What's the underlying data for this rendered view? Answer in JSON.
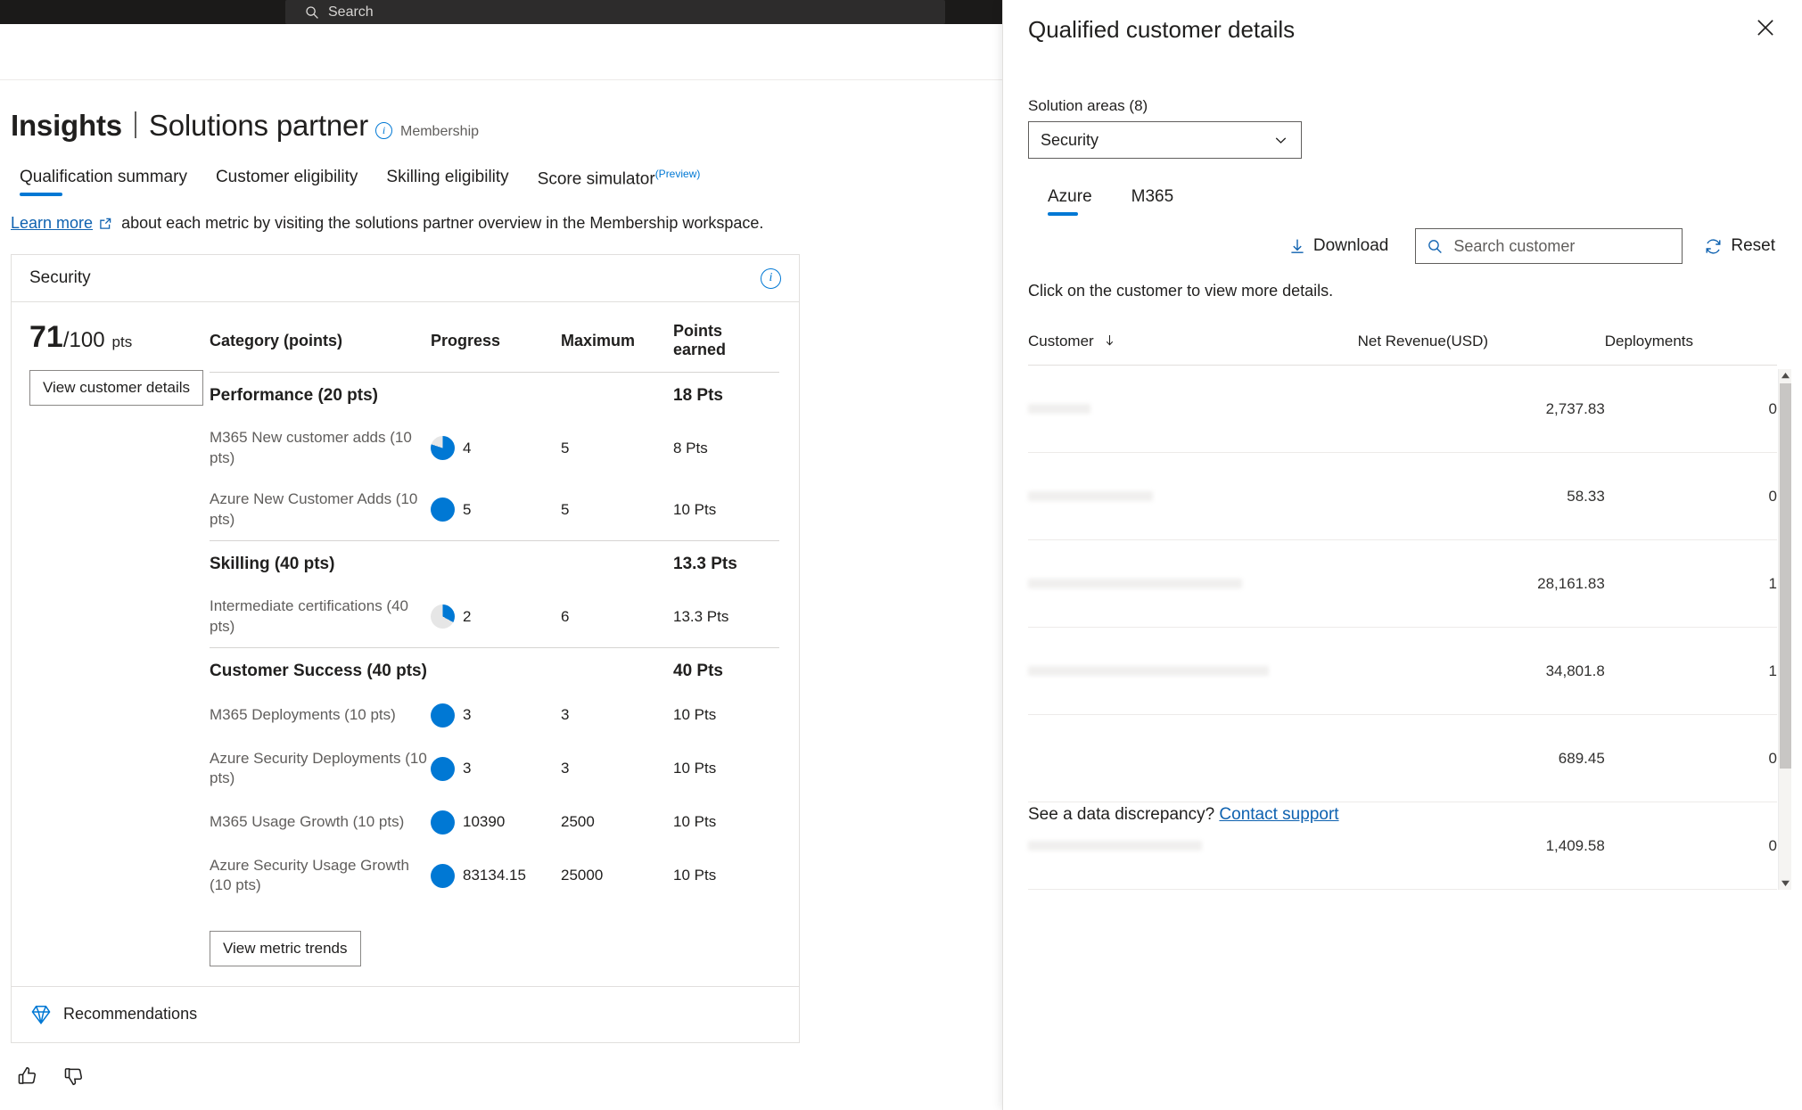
{
  "topbar": {
    "search_placeholder": "Search"
  },
  "header": {
    "title_primary": "Insights",
    "title_secondary": "Solutions partner",
    "subtitle": "Membership",
    "info_glyph": "i"
  },
  "tabs": [
    {
      "label": "Qualification summary",
      "sup": "",
      "active": true
    },
    {
      "label": "Customer eligibility",
      "sup": "",
      "active": false
    },
    {
      "label": "Skilling eligibility",
      "sup": "",
      "active": false
    },
    {
      "label": "Score simulator",
      "sup": "(Preview)",
      "active": false
    }
  ],
  "learn": {
    "link": "Learn more",
    "rest": "about each metric by visiting the solutions partner overview in the Membership workspace."
  },
  "card": {
    "title": "Security",
    "score_value": "71",
    "score_denominator": "/100",
    "score_unit": "pts",
    "view_customer_details": "View customer details",
    "view_metric_trends": "View metric trends",
    "recommendations": "Recommendations",
    "columns": [
      "Category (points)",
      "Progress",
      "Maximum",
      "Points earned"
    ],
    "groups": [
      {
        "name": "Performance (20 pts)",
        "points_earned": "18 Pts",
        "items": [
          {
            "label": "M365 New customer adds (10 pts)",
            "progress": "4",
            "maximum": "5",
            "points_earned": "8 Pts",
            "fill_pct": 80
          },
          {
            "label": "Azure New Customer Adds (10 pts)",
            "progress": "5",
            "maximum": "5",
            "points_earned": "10 Pts",
            "fill_pct": 100
          }
        ]
      },
      {
        "name": "Skilling (40 pts)",
        "points_earned": "13.3 Pts",
        "items": [
          {
            "label": "Intermediate certifications (40 pts)",
            "progress": "2",
            "maximum": "6",
            "points_earned": "13.3 Pts",
            "fill_pct": 33
          }
        ]
      },
      {
        "name": "Customer Success (40 pts)",
        "points_earned": "40 Pts",
        "items": [
          {
            "label": "M365 Deployments (10 pts)",
            "progress": "3",
            "maximum": "3",
            "points_earned": "10 Pts",
            "fill_pct": 100
          },
          {
            "label": "Azure Security Deployments (10 pts)",
            "progress": "3",
            "maximum": "3",
            "points_earned": "10 Pts",
            "fill_pct": 100
          },
          {
            "label": "M365 Usage Growth (10 pts)",
            "progress": "10390",
            "maximum": "2500",
            "points_earned": "10 Pts",
            "fill_pct": 100
          },
          {
            "label": "Azure Security Usage Growth (10 pts)",
            "progress": "83134.15",
            "maximum": "25000",
            "points_earned": "10 Pts",
            "fill_pct": 100
          }
        ]
      }
    ]
  },
  "panel": {
    "title": "Qualified customer details",
    "solution_areas_label": "Solution areas (8)",
    "solution_area_selected": "Security",
    "tabs": [
      {
        "label": "Azure",
        "active": true
      },
      {
        "label": "M365",
        "active": false
      }
    ],
    "download_label": "Download",
    "search_placeholder": "Search customer",
    "search_value": "",
    "reset_label": "Reset",
    "hint": "Click on the customer to view more details.",
    "columns": [
      "Customer",
      "Net Revenue(USD)",
      "Deployments"
    ],
    "sort_column": "Customer",
    "sort_direction": "descending",
    "rows": [
      {
        "customer": "",
        "net_revenue": "2,737.83",
        "deployments": "0"
      },
      {
        "customer": "",
        "net_revenue": "58.33",
        "deployments": "0"
      },
      {
        "customer": "",
        "net_revenue": "28,161.83",
        "deployments": "1"
      },
      {
        "customer": "",
        "net_revenue": "34,801.8",
        "deployments": "1"
      },
      {
        "customer": "",
        "net_revenue": "689.45",
        "deployments": "0"
      },
      {
        "customer": "",
        "net_revenue": "1,409.58",
        "deployments": "0"
      }
    ],
    "footer_text": "See a data discrepancy?",
    "footer_link": "Contact support"
  },
  "colors": {
    "accent": "#0078d4",
    "link": "#0f62b0",
    "track": "#e6e6e6",
    "text": "#201f1e",
    "muted": "#605e5c"
  }
}
